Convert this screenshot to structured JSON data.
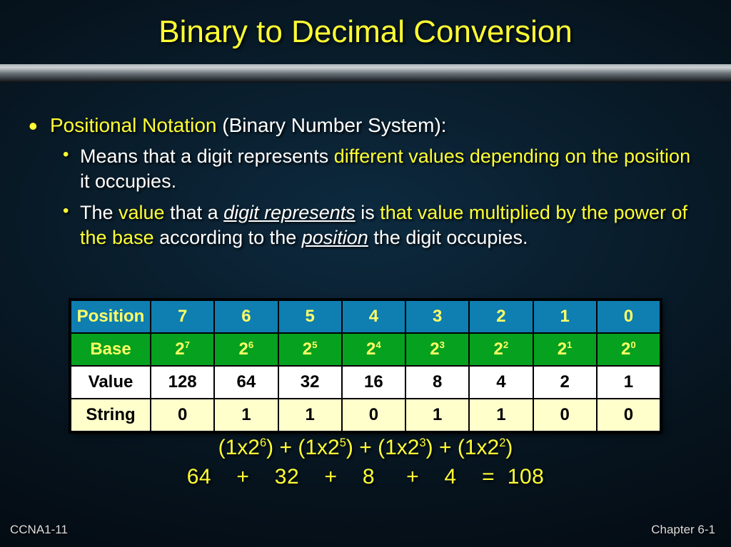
{
  "title": "Binary to Decimal Conversion",
  "bullet": {
    "lead_y": "Positional Notation",
    "lead_w": " (Binary Number System):",
    "sub1_a": "Means that a digit represents ",
    "sub1_y1": "different values depending on the position",
    "sub1_b": " it occupies.",
    "sub2_a": "The ",
    "sub2_y1": "value",
    "sub2_b": " that a ",
    "sub2_u1": "digit represents",
    "sub2_c": " is ",
    "sub2_y2": "that value multiplied by the power of the base",
    "sub2_d": " according to the ",
    "sub2_u2": "position",
    "sub2_e": " the digit occupies."
  },
  "table": {
    "headers": {
      "pos": "Position",
      "base": "Base",
      "value": "Value",
      "string": "String"
    },
    "positions": [
      "7",
      "6",
      "5",
      "4",
      "3",
      "2",
      "1",
      "0"
    ],
    "base_label": "2",
    "base_exps": [
      "7",
      "6",
      "5",
      "4",
      "3",
      "2",
      "1",
      "0"
    ],
    "values": [
      "128",
      "64",
      "32",
      "16",
      "8",
      "4",
      "2",
      "1"
    ],
    "string": [
      "0",
      "1",
      "1",
      "0",
      "1",
      "1",
      "0",
      "0"
    ]
  },
  "calc": {
    "t": {
      "a": "(1x2",
      "e1": "6",
      "b": ") + (1x2",
      "e2": "5",
      "c": ") + (1x2",
      "e3": "3",
      "d": ") + (1x2",
      "e4": "2",
      "e": ")"
    },
    "line2": "64    +    32    +    8     +    4    =  108"
  },
  "footer": {
    "left": "CCNA1-11",
    "right": "Chapter 6-1"
  }
}
